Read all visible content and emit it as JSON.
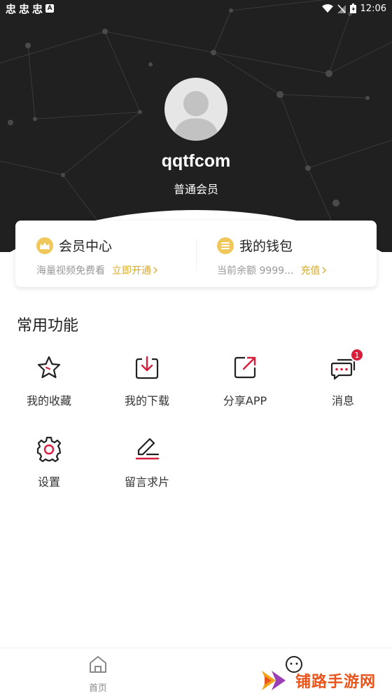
{
  "status_bar": {
    "notification_glyphs": [
      "忠",
      "忠",
      "忠"
    ],
    "a_badge": "A",
    "time": "12:06"
  },
  "profile": {
    "username": "qqtfcom",
    "level": "普通会员"
  },
  "card": {
    "vip": {
      "title": "会员中心",
      "desc": "海量视频免费看",
      "action": "立即开通"
    },
    "wallet": {
      "title": "我的钱包",
      "desc": "当前余额 9999...",
      "action": "充值"
    }
  },
  "section": {
    "title": "常用功能"
  },
  "functions": [
    {
      "label": "我的收藏",
      "icon": "star-icon"
    },
    {
      "label": "我的下载",
      "icon": "download-icon"
    },
    {
      "label": "分享APP",
      "icon": "share-icon"
    },
    {
      "label": "消息",
      "icon": "message-icon",
      "badge": "1"
    },
    {
      "label": "设置",
      "icon": "gear-icon"
    },
    {
      "label": "留言求片",
      "icon": "edit-icon"
    }
  ],
  "tabbar": {
    "home": {
      "label": "首页",
      "icon": "home-icon"
    }
  },
  "watermark": {
    "text": "铺路手游网"
  },
  "colors": {
    "accent": "#d8a928",
    "header_bg": "#202020",
    "badge": "#d81e3c",
    "icon_red": "#d81e3c"
  }
}
